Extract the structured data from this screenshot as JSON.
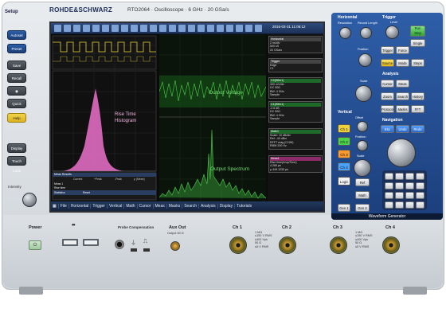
{
  "brand": {
    "name": "ROHDE&SCHWARZ",
    "model": "RTO2064",
    "type": "Oscilloscope",
    "bandwidth": "6 GHz",
    "rate": "20 GSa/s"
  },
  "left_panel": {
    "setup_label": "Setup",
    "buttons": [
      "Autoset",
      "Preset",
      "Save",
      "Recall",
      "",
      "Quick Mkrs",
      "Help",
      "Display",
      "Touch Lock",
      "Intensity"
    ]
  },
  "screen": {
    "datetime": "2016-03-31 11:06:12",
    "labels": {
      "output_voltage": "Output Voltage",
      "rise_time": "Rise Time",
      "histogram": "Histogram",
      "output_spectrum": "Output Spectrum"
    },
    "meas_results": {
      "title": "Meas Results",
      "cols": [
        "Current",
        "+Peak",
        "-Peak",
        "μ (Mean)"
      ],
      "row1": "Meas 1",
      "rise": "Rise time"
    },
    "statistics": "Statistics",
    "reset": "Reset",
    "info_boxes": {
      "horizontal": {
        "title": "Horizontal",
        "lines": [
          "2 ns/div",
          "500 kS",
          "20 GSa/s",
          "0.00 s"
        ]
      },
      "trigger": {
        "title": "Trigger",
        "lines": [
          "Edge",
          "C1",
          "A 0.0 V"
        ]
      },
      "c2": {
        "title": "C2(Wfm1)",
        "lines": [
          "400 mV/div",
          "DC 50Ω",
          "BW: 4 GHz",
          "Sample"
        ]
      },
      "c1": {
        "title": "C1(Wfm1)",
        "lines": [
          "-2.6 dB",
          "DC 50Ω",
          "BW: 4 GHz",
          "Sample"
        ]
      },
      "math1": {
        "title": "Math1",
        "lines": [
          "Scale: 10 dB/div",
          "Ref: -40 dBm",
          "RFFT mag (C1Wf)",
          "RBW 200 Hz"
        ]
      },
      "meas": {
        "title": "Meas1",
        "lines": [
          "Rise time(Amp/Time)",
          "4.289 ps",
          "μ 449.1230 ps"
        ]
      }
    },
    "menu": [
      "File",
      "Horizontal",
      "Trigger",
      "Vertical",
      "Math",
      "Cursor",
      "Meas",
      "Masks",
      "Search",
      "Analysis",
      "Display",
      "Tutorials"
    ]
  },
  "right_panel": {
    "horizontal_title": "Horizontal",
    "trigger_title": "Trigger",
    "analysis_title": "Analysis",
    "vertical_title": "Vertical",
    "navigation_title": "Navigation",
    "h_labels": [
      "Resolution",
      "Record Length",
      "Position",
      "Scale"
    ],
    "trigger_btns": [
      "Level",
      "Run Stop",
      "Single",
      "Trigger",
      "Source",
      "Mode",
      "Steps",
      "Force"
    ],
    "analysis_btns": [
      "Cursor",
      "Meas",
      "Zoom",
      "Search",
      "History",
      "Protocol",
      "Masks",
      "FFT"
    ],
    "vertical_btns": [
      "Offset",
      "Position",
      "Scale"
    ],
    "channel_btns": [
      "Ch 1",
      "Ch 2",
      "Ch 3",
      "Ch 4",
      "Logic",
      "Ref",
      "Math",
      "Gen 1",
      "Gen 2"
    ],
    "nav_btns": [
      "Esc",
      "Undo",
      "Redo"
    ],
    "waveform_generator": "Waveform Generator"
  },
  "bottom": {
    "power": "Power",
    "usb": "⬌",
    "probe_comp": "Probe Compensation",
    "aux_out": "Aux Out",
    "aux_sub": "Output 50 Ω",
    "channels": [
      "Ch 1",
      "Ch 2",
      "Ch 3",
      "Ch 4"
    ],
    "ch_spec": [
      "1 MΩ",
      "≤150 V RMS",
      "≤400 Vpk",
      "50 Ω",
      "≤5 V RMS"
    ]
  },
  "colors": {
    "panel_blue": "#1c3f7c",
    "trace_green": "#49d349",
    "histo_pink": "#e06bc1",
    "ch1": "#f0d23a",
    "ch2": "#4ad24a",
    "ch3": "#ff9a2e",
    "ch4": "#4aa2ff"
  }
}
